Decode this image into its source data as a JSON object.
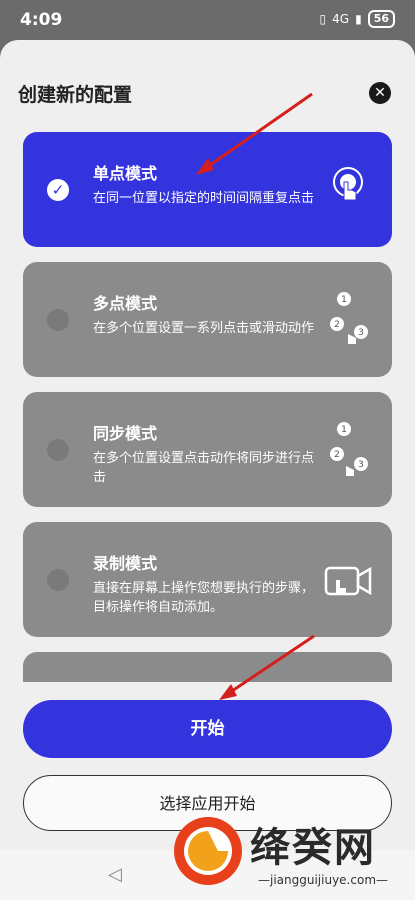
{
  "status": {
    "time": "4:09",
    "network": "4G",
    "battery": "56"
  },
  "dialog": {
    "title": "创建新的配置",
    "modes": [
      {
        "title": "单点模式",
        "description": "在同一位置以指定的时间间隔重复点击",
        "selected": true,
        "icon": "single-tap-icon"
      },
      {
        "title": "多点模式",
        "description": "在多个位置设置一系列点击或滑动动作",
        "selected": false,
        "icon": "multi-tap-icon"
      },
      {
        "title": "同步模式",
        "description": "在多个位置设置点击动作将同步进行点击",
        "selected": false,
        "icon": "sync-tap-icon"
      },
      {
        "title": "录制模式",
        "description": "直接在屏幕上操作您想要执行的步骤，目标操作将自动添加。",
        "selected": false,
        "icon": "record-icon"
      }
    ],
    "start_label": "开始",
    "choose_app_label": "选择应用开始"
  },
  "watermark": {
    "name": "绛癸网",
    "url": "—jiangguijiuye.com—"
  },
  "colors": {
    "accent": "#3434de",
    "card_inactive": "#8b8b8b",
    "arrow": "#d51e1e"
  }
}
